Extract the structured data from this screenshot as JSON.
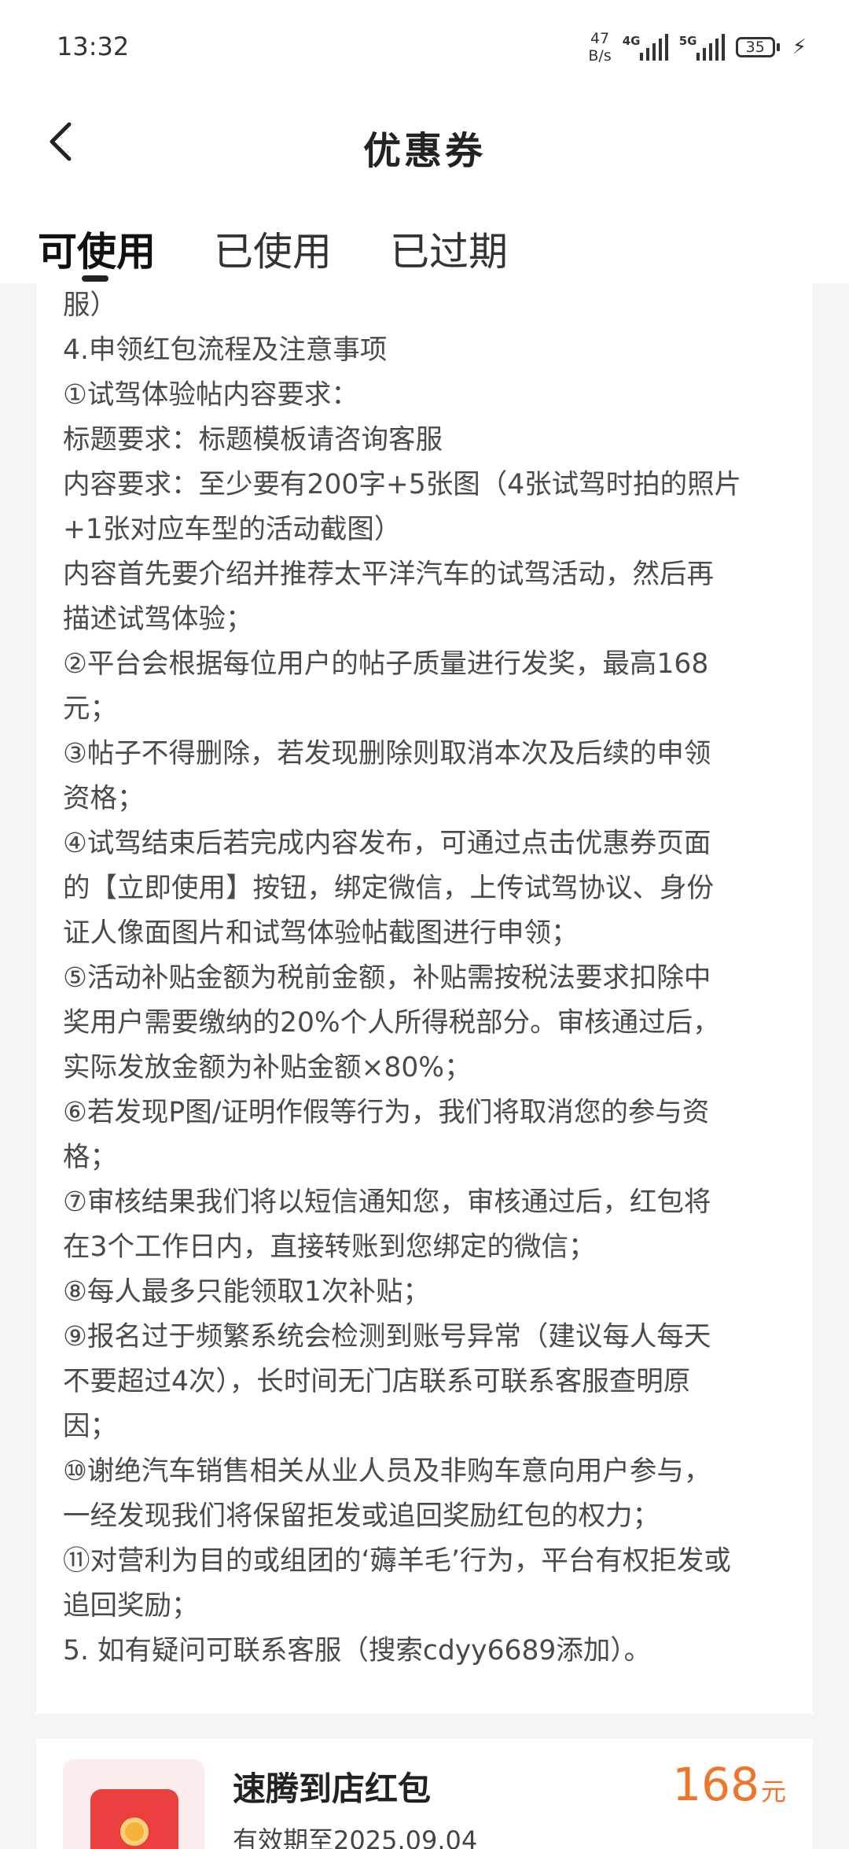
{
  "status": {
    "time": "13:32",
    "net_speed_value": "47",
    "net_speed_unit": "B/s",
    "sim1_label": "4G",
    "sim2_label": "5G",
    "battery": "35",
    "icons": [
      "signal-icon",
      "battery-icon",
      "charging-icon"
    ]
  },
  "header": {
    "title": "优惠券",
    "back_icon": "chevron-left-icon"
  },
  "tabs": [
    {
      "label": "可使用",
      "active": true
    },
    {
      "label": "已使用",
      "active": false
    },
    {
      "label": "已过期",
      "active": false
    }
  ],
  "rules": {
    "lines": [
      "服）",
      "4.申领红包流程及注意事项",
      "①试驾体验帖内容要求：",
      "标题要求：标题模板请咨询客服",
      "内容要求：至少要有200字+5张图（4张试驾时拍的照片",
      "+1张对应车型的活动截图）",
      "内容首先要介绍并推荐太平洋汽车的试驾活动，然后再",
      "描述试驾体验；",
      "②平台会根据每位用户的帖子质量进行发奖，最高168",
      "元；",
      "③帖子不得删除，若发现删除则取消本次及后续的申领",
      "资格；",
      "④试驾结束后若完成内容发布，可通过点击优惠券页面",
      "的【立即使用】按钮，绑定微信，上传试驾协议、身份",
      "证人像面图片和试驾体验帖截图进行申领；",
      "⑤活动补贴金额为税前金额，补贴需按税法要求扣除中",
      "奖用户需要缴纳的20%个人所得税部分。审核通过后，",
      "实际发放金额为补贴金额×80%；",
      "⑥若发现P图/证明作假等行为，我们将取消您的参与资",
      "格；",
      "⑦审核结果我们将以短信通知您，审核通过后，红包将",
      "在3个工作日内，直接转账到您绑定的微信；",
      "⑧每人最多只能领取1次补贴；",
      "⑨报名过于频繁系统会检测到账号异常（建议每人每天",
      "不要超过4次），长时间无门店联系可联系客服查明原",
      "因；",
      "⑩谢绝汽车销售相关从业人员及非购车意向用户参与，",
      "一经发现我们将保留拒发或追回奖励红包的权力；",
      "⑪对营利为目的或组团的‘薅羊毛’行为，平台有权拒发或",
      "追回奖励；",
      "5. 如有疑问可联系客服（搜索cdyy6689添加）。"
    ]
  },
  "coupon": {
    "name": "速腾到店红包",
    "validity": "有效期至2025.09.04",
    "amount": "168",
    "unit": "元",
    "icon": "red-packet-icon",
    "colors": {
      "amount": "#f0742a",
      "packet": "#ea3f3f"
    }
  }
}
